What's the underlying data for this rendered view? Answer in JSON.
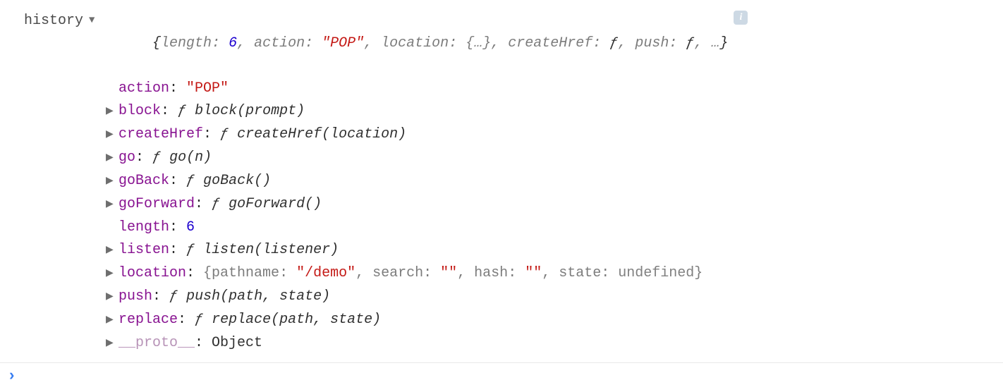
{
  "variableName": "history",
  "summary": {
    "open": "{",
    "lengthKey": "length",
    "lengthVal": "6",
    "actionKey": "action",
    "actionVal": "\"POP\"",
    "locationKey": "location",
    "locationVal": "{…}",
    "createHrefKey": "createHref",
    "createHrefVal": "ƒ",
    "pushKey": "push",
    "pushVal": "ƒ",
    "rest": "…",
    "close": "}"
  },
  "infoGlyph": "i",
  "props": {
    "action": {
      "key": "action",
      "val": "\"POP\""
    },
    "block": {
      "key": "block",
      "f": "ƒ",
      "sig": "block(prompt)"
    },
    "createHref": {
      "key": "createHref",
      "f": "ƒ",
      "sig": "createHref(location)"
    },
    "go": {
      "key": "go",
      "f": "ƒ",
      "sig": "go(n)"
    },
    "goBack": {
      "key": "goBack",
      "f": "ƒ",
      "sig": "goBack()"
    },
    "goForward": {
      "key": "goForward",
      "f": "ƒ",
      "sig": "goForward()"
    },
    "length": {
      "key": "length",
      "val": "6"
    },
    "listen": {
      "key": "listen",
      "f": "ƒ",
      "sig": "listen(listener)"
    },
    "location": {
      "key": "location",
      "open": "{",
      "pathnameKey": "pathname",
      "pathnameVal": "\"/demo\"",
      "searchKey": "search",
      "searchVal": "\"\"",
      "hashKey": "hash",
      "hashVal": "\"\"",
      "stateKey": "state",
      "stateVal": "undefined",
      "close": "}"
    },
    "push": {
      "key": "push",
      "f": "ƒ",
      "sig": "push(path, state)"
    },
    "replace": {
      "key": "replace",
      "f": "ƒ",
      "sig": "replace(path, state)"
    },
    "proto": {
      "key": "__proto__",
      "val": "Object"
    }
  },
  "promptSymbol": "›"
}
